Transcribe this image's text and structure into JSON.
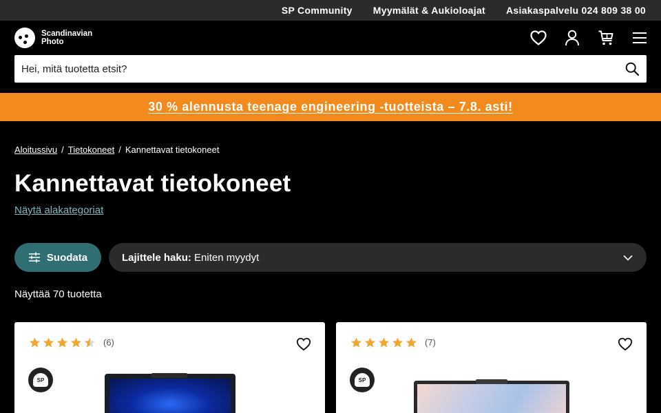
{
  "topbar": {
    "community": "SP Community",
    "stores": "Myymälät & Aukioloajat",
    "customer_service": "Asiakaspalvelu 024 809 38 00"
  },
  "header": {
    "logo_line1": "Scandinavian",
    "logo_line2": "Photo",
    "icons": [
      "heart-icon",
      "user-icon",
      "cart-icon",
      "menu-icon"
    ]
  },
  "search": {
    "placeholder": "Hei, mitä tuotetta etsit?",
    "value": ""
  },
  "promo": {
    "text": "30 % alennusta teenage engineering -tuotteista – 7.8. asti!",
    "color": "#f28a1d"
  },
  "breadcrumb": {
    "items": [
      "Aloitussivu",
      "Tietokoneet",
      "Kannettavat tietokoneet"
    ],
    "separator": "/"
  },
  "page": {
    "title": "Kannettavat tietokoneet",
    "subcategories_link": "Näytä alakategoriat",
    "filter_label": "Suodata",
    "sort_label": "Lajittele haku:",
    "sort_value": "Eniten myydyt",
    "result_count": "Näyttää 70 tuotetta"
  },
  "products": [
    {
      "rating_count": "(6)",
      "stars": 4.5,
      "badge": "SP"
    },
    {
      "rating_count": "(7)",
      "stars": 5,
      "badge": "SP"
    }
  ],
  "colors": {
    "accent": "#2f6e73",
    "link": "#7fb6bd",
    "star": "#f0a830"
  }
}
